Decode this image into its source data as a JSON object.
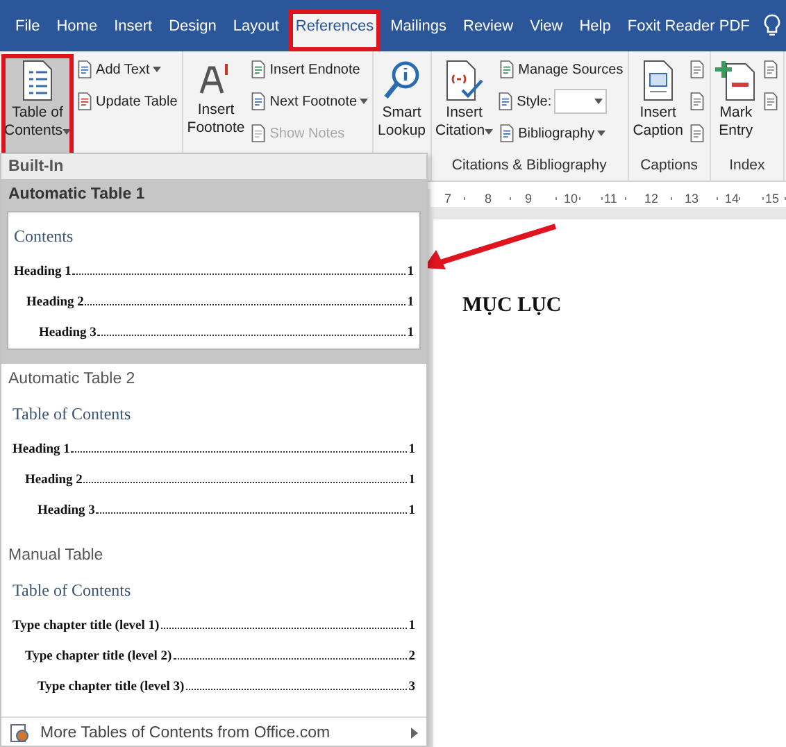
{
  "tabs": [
    {
      "label": "File",
      "selected": false,
      "highlighted": false
    },
    {
      "label": "Home",
      "selected": false,
      "highlighted": false
    },
    {
      "label": "Insert",
      "selected": false,
      "highlighted": false
    },
    {
      "label": "Design",
      "selected": false,
      "highlighted": false
    },
    {
      "label": "Layout",
      "selected": false,
      "highlighted": false
    },
    {
      "label": "References",
      "selected": true,
      "highlighted": true
    },
    {
      "label": "Mailings",
      "selected": false,
      "highlighted": false
    },
    {
      "label": "Review",
      "selected": false,
      "highlighted": false
    },
    {
      "label": "View",
      "selected": false,
      "highlighted": false
    },
    {
      "label": "Help",
      "selected": false,
      "highlighted": false
    },
    {
      "label": "Foxit Reader PDF",
      "selected": false,
      "highlighted": false
    }
  ],
  "ribbon": {
    "groups": [
      {
        "columns": [
          [
            {
              "kind": "large",
              "label": "Table of\nContents",
              "dropdown": true,
              "disabled": false,
              "highlighted": true
            }
          ],
          [
            {
              "kind": "small",
              "label": "Add Text",
              "dropdown": true,
              "disabled": false
            },
            {
              "kind": "small",
              "label": "Update Table",
              "dropdown": false,
              "disabled": false
            }
          ]
        ]
      },
      {
        "columns": [
          [
            {
              "kind": "large",
              "label": "Insert\nFootnote",
              "dropdown": false,
              "disabled": false,
              "highlighted": false
            }
          ],
          [
            {
              "kind": "small",
              "label": "Insert Endnote",
              "dropdown": false,
              "disabled": false
            },
            {
              "kind": "small",
              "label": "Next Footnote",
              "dropdown": true,
              "disabled": false
            },
            {
              "kind": "small",
              "label": "Show Notes",
              "dropdown": false,
              "disabled": true
            }
          ]
        ]
      },
      {
        "columns": [
          [
            {
              "kind": "large",
              "label": "Smart\nLookup",
              "dropdown": false,
              "disabled": false,
              "highlighted": false
            }
          ]
        ]
      },
      {
        "label": "Citations & Bibliography",
        "columns": [
          [
            {
              "kind": "large",
              "label": "Insert\nCitation",
              "dropdown": true,
              "disabled": false,
              "highlighted": false
            }
          ],
          [
            {
              "kind": "small",
              "label": "Manage Sources",
              "dropdown": false,
              "disabled": false
            },
            {
              "kind": "field",
              "label": "Style:"
            },
            {
              "kind": "small",
              "label": "Bibliography",
              "dropdown": true,
              "disabled": false
            }
          ]
        ]
      },
      {
        "label": "Captions",
        "columns": [
          [
            {
              "kind": "large",
              "label": "Insert\nCaption",
              "dropdown": false,
              "disabled": false,
              "highlighted": false
            }
          ],
          [
            {
              "kind": "icon"
            },
            {
              "kind": "icon"
            },
            {
              "kind": "icon"
            }
          ]
        ]
      },
      {
        "label": "Index",
        "columns": [
          [
            {
              "kind": "large",
              "label": "Mark\nEntry",
              "dropdown": false,
              "disabled": false,
              "highlighted": false
            }
          ],
          [
            {
              "kind": "icon"
            },
            {
              "kind": "icon"
            }
          ]
        ]
      }
    ]
  },
  "toc_menu": {
    "header": "Built-In",
    "sections": [
      {
        "title": "Automatic Table 1",
        "selected": true,
        "preview": {
          "title": "Contents",
          "entries": [
            {
              "text": "Heading 1",
              "page": "1",
              "children": [
                {
                  "text": "Heading 2",
                  "page": "1",
                  "children": [
                    {
                      "text": "Heading 3",
                      "page": "1"
                    }
                  ]
                }
              ]
            }
          ]
        }
      },
      {
        "title": "Automatic Table 2",
        "selected": false,
        "preview": {
          "title": "Table of Contents",
          "entries": [
            {
              "text": "Heading 1",
              "page": "1",
              "children": [
                {
                  "text": "Heading 2",
                  "page": "1",
                  "children": [
                    {
                      "text": "Heading 3",
                      "page": "1"
                    }
                  ]
                }
              ]
            }
          ]
        }
      },
      {
        "title": "Manual Table",
        "selected": false,
        "preview": {
          "title": "Table of Contents",
          "entries": [
            {
              "text": "Type chapter title (level 1)",
              "page": "1",
              "children": [
                {
                  "text": "Type chapter title (level 2)",
                  "page": "2",
                  "children": [
                    {
                      "text": "Type chapter title (level 3)",
                      "page": "3"
                    }
                  ]
                }
              ]
            }
          ]
        }
      }
    ],
    "footer": "More Tables of Contents from Office.com"
  },
  "document": {
    "ruler": [
      "7",
      "8",
      "9",
      "10",
      "11",
      "12",
      "13",
      "14",
      "15"
    ],
    "text": "MỤC LỤC"
  }
}
